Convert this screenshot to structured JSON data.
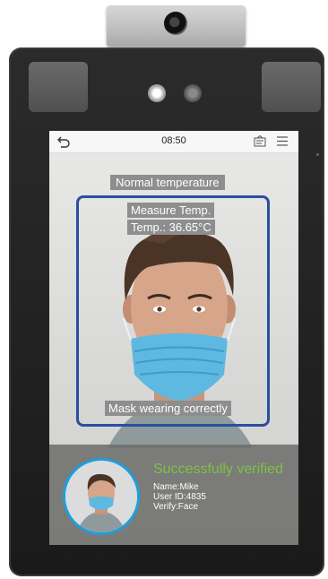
{
  "status_bar": {
    "time": "08:50"
  },
  "overlay": {
    "temperature_status": "Normal temperature",
    "measure_label": "Measure Temp.",
    "temperature_reading": "Temp.: 36.65°C",
    "mask_status": "Mask wearing correctly"
  },
  "result": {
    "title": "Successfully verified",
    "name": "Name:Mike",
    "user_id": "User ID:4835",
    "verify_mode": "Verify:Face"
  },
  "colors": {
    "frame": "#2a4f9e",
    "verified_text": "#7cc242",
    "avatar_ring": "#1aa0e0",
    "mask": "#5fb8e0"
  },
  "icons": [
    "back-icon",
    "document-icon",
    "menu-icon",
    "camera-icon"
  ]
}
